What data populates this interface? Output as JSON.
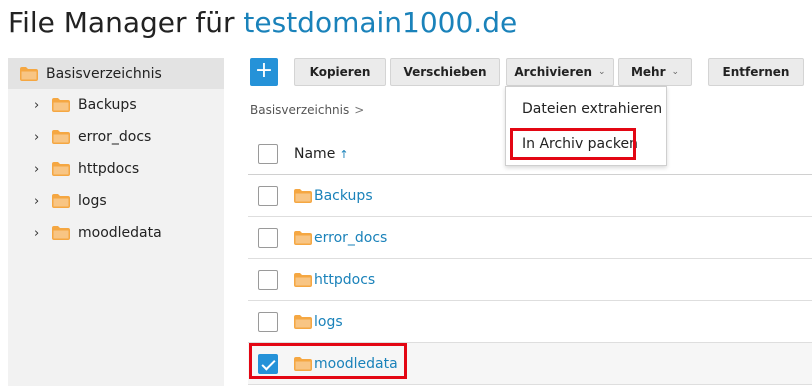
{
  "page": {
    "title_prefix": "File Manager für ",
    "title_domain": "testdomain1000.de"
  },
  "sidebar": {
    "root_label": "Basisverzeichnis",
    "items": [
      {
        "label": "Backups"
      },
      {
        "label": "error_docs"
      },
      {
        "label": "httpdocs"
      },
      {
        "label": "logs"
      },
      {
        "label": "moodledata"
      }
    ]
  },
  "toolbar": {
    "add_label": "+",
    "copy_label": "Kopieren",
    "move_label": "Verschieben",
    "archive_label": "Archivieren",
    "more_label": "Mehr",
    "remove_label": "Entfernen"
  },
  "breadcrumb": {
    "root": "Basisverzeichnis",
    "separator": ">"
  },
  "archive_menu": {
    "items": [
      {
        "label": "Dateien extrahieren"
      },
      {
        "label": "In Archiv packen"
      }
    ]
  },
  "table": {
    "name_header": "Name",
    "sort_indicator": "↑",
    "rows": [
      {
        "name": "Backups",
        "checked": false
      },
      {
        "name": "error_docs",
        "checked": false
      },
      {
        "name": "httpdocs",
        "checked": false
      },
      {
        "name": "logs",
        "checked": false
      },
      {
        "name": "moodledata",
        "checked": true
      }
    ]
  },
  "colors": {
    "accent": "#2592d8",
    "link": "#1a82ba",
    "folder": "#f5a742",
    "highlight": "#e30613"
  }
}
